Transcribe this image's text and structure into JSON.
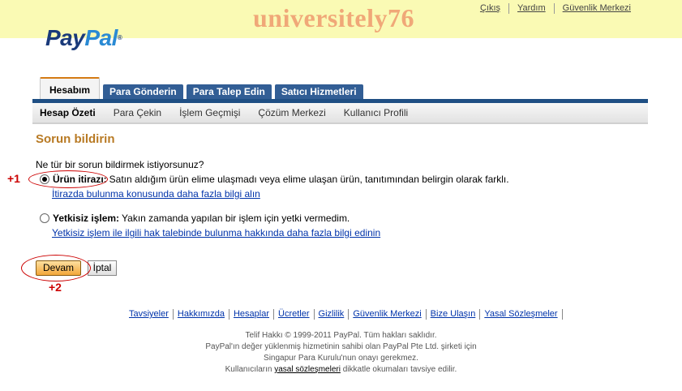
{
  "watermark": "universitely76",
  "logo": {
    "pay": "Pay",
    "pal": "Pal",
    "tm": "®"
  },
  "toplinks": [
    "Çıkış",
    "Yardım",
    "Güvenlik Merkezi"
  ],
  "tabs": [
    {
      "label": "Hesabım",
      "active": true
    },
    {
      "label": "Para Gönderin",
      "active": false
    },
    {
      "label": "Para Talep Edin",
      "active": false
    },
    {
      "label": "Satıcı Hizmetleri",
      "active": false
    }
  ],
  "subnav": [
    "Hesap Özeti",
    "Para Çekin",
    "İşlem Geçmişi",
    "Çözüm Merkezi",
    "Kullanıcı Profili"
  ],
  "page": {
    "title": "Sorun bildirin",
    "question": "Ne tür bir sorun bildirmek istiyorsunuz?",
    "option1": {
      "label": "Ürün itirazı:",
      "desc": "Satın aldığım ürün elime ulaşmadı veya elime ulaşan ürün, tanıtımından belirgin olarak farklı.",
      "link": "İtirazda bulunma konusunda daha fazla bilgi alın",
      "checked": true
    },
    "option2": {
      "label": "Yetkisiz işlem:",
      "desc": "Yakın zamanda yapılan bir işlem için yetki vermedim.",
      "link": "Yetkisiz işlem ile ilgili hak talebinde bulunma hakkında daha fazla bilgi edinin",
      "checked": false
    },
    "continue_label": "Devam",
    "cancel_label": "İptal"
  },
  "annotations": {
    "one": "+1",
    "two": "+2",
    "color": "#cc0000"
  },
  "footer": {
    "links": [
      "Tavsiyeler",
      "Hakkımızda",
      "Hesaplar",
      "Ücretler",
      "Gizlilik",
      "Güvenlik Merkezi",
      "Bize Ulaşın",
      "Yasal Sözleşmeler"
    ],
    "line1": "Telif Hakkı © 1999-2011 PayPal. Tüm hakları saklıdır.",
    "line2": "PayPal'ın değer yüklenmiş hizmetinin sahibi olan PayPal Pte Ltd. şirketi için",
    "line3": "Singapur Para Kurulu'nun onayı gerekmez.",
    "line4_pre": "Kullanıcıların",
    "line4_link": "yasal sözleşmeleri",
    "line4_post": "dikkatle okumaları tavsiye edilir."
  }
}
